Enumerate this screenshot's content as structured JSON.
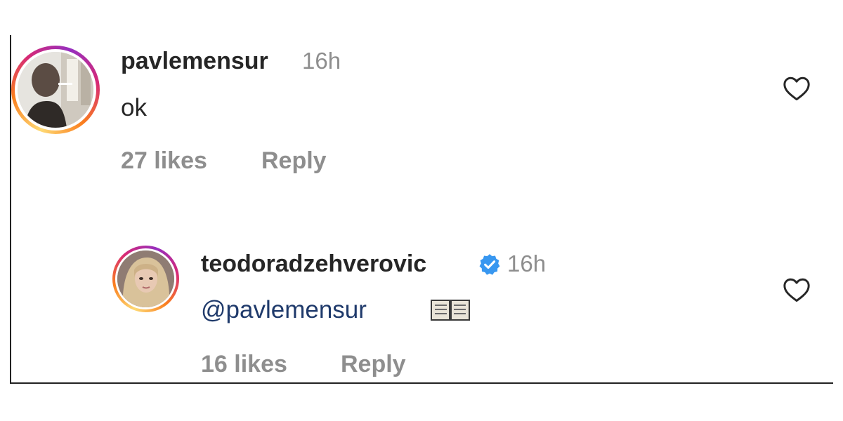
{
  "comments": [
    {
      "username": "pavlemensur",
      "time": "16h",
      "text": "ok",
      "likes": "27 likes",
      "reply_label": "Reply",
      "verified": false
    },
    {
      "username": "teodoradzehverovic",
      "time": "16h",
      "mention": "@pavlemensur",
      "emoji": "open-book-icon",
      "likes": "16 likes",
      "reply_label": "Reply",
      "verified": true
    }
  ],
  "colors": {
    "verified_blue": "#3897f0",
    "meta_gray": "#8e8e8e",
    "mention": "#1f3a6b"
  }
}
